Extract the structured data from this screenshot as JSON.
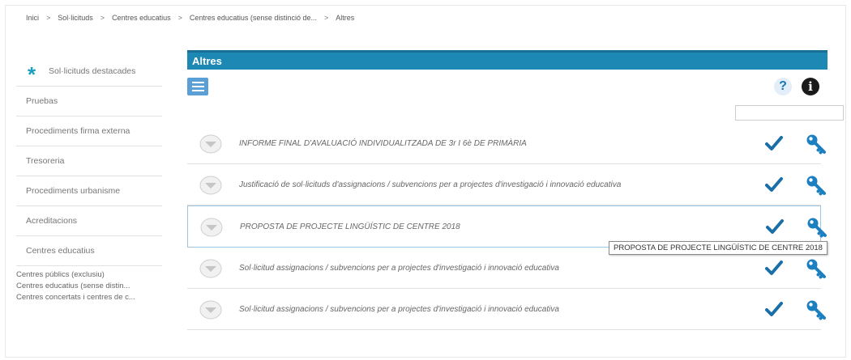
{
  "breadcrumb": [
    "Inici",
    "Sol·licituds",
    "Centres educatius",
    "Centres educatius (sense distinció de...",
    "Altres"
  ],
  "breadcrumb_separator": ">",
  "sidebar": {
    "items": [
      {
        "label": "Sol·licituds destacades",
        "icon": "asterisk-icon"
      },
      {
        "label": "Pruebas"
      },
      {
        "label": "Procediments firma externa"
      },
      {
        "label": "Tresoreria"
      },
      {
        "label": "Procediments urbanisme"
      },
      {
        "label": "Acreditacions"
      },
      {
        "label": "Centres educatius"
      }
    ],
    "subitems": [
      "Centres públics (exclusiu)",
      "Centres educatius (sense distin...",
      "Centres concertats i centres de c..."
    ]
  },
  "section": {
    "title": "Altres",
    "help_label": "?",
    "info_label": "i",
    "search_value": ""
  },
  "procedures": [
    {
      "title": "INFORME FINAL D'AVALUACIÓ INDIVIDUALITZADA DE 3r I 6è DE PRIMÀRIA"
    },
    {
      "title": "Justificació de sol·licituds d'assignacions / subvencions per a projectes d'investigació i innovació educativa"
    },
    {
      "title": "PROPOSTA DE PROJECTE LINGÜÍSTIC DE CENTRE 2018",
      "active": true
    },
    {
      "title": "Sol·licitud assignacions / subvencions per a projectes d'investigació i innovació educativa"
    },
    {
      "title": "Sol·licitud assignacions / subvencions per a projectes d'investigació i innovació educativa"
    }
  ],
  "tooltip": "PROPOSTA DE PROJECTE LINGÜÍSTIC DE CENTRE 2018",
  "colors": {
    "header_bg": "#1e88b5",
    "accent": "#1aa0bd",
    "check": "#1a6fa8",
    "key": "#1c7fc0"
  }
}
